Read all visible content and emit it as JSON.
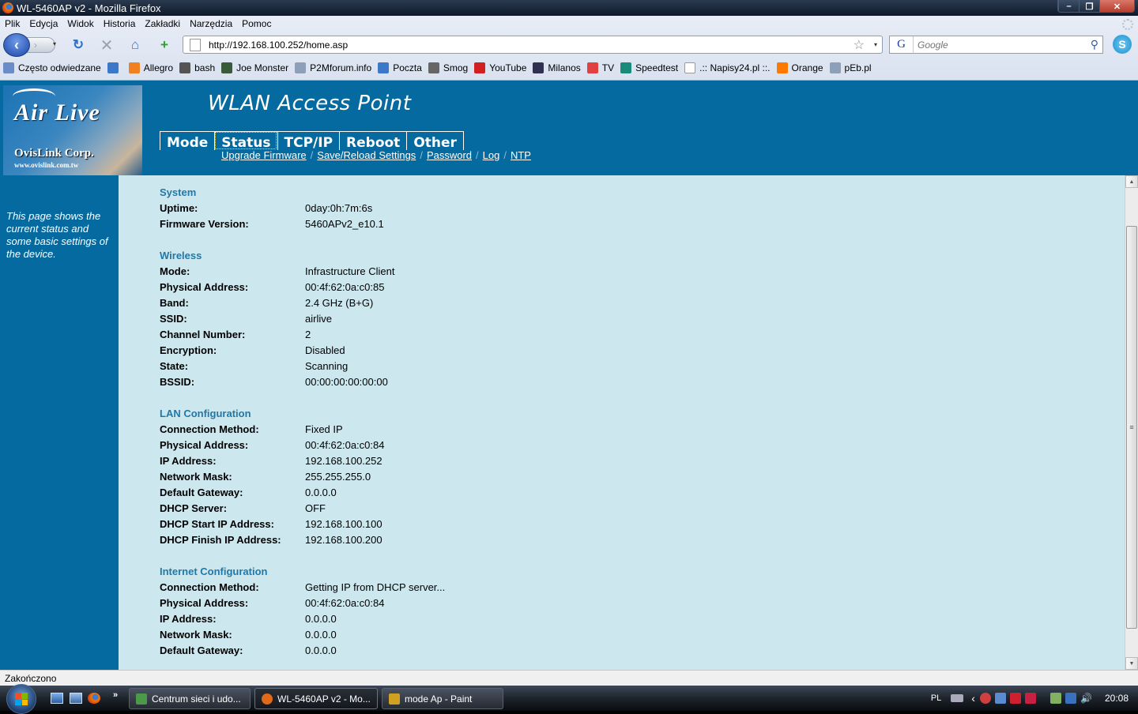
{
  "window": {
    "title": "WL-5460AP v2 - Mozilla Firefox",
    "controls": {
      "minimize": "–",
      "restore": "❐",
      "close": "✕"
    }
  },
  "menubar": [
    {
      "label": "Plik"
    },
    {
      "label": "Edycja"
    },
    {
      "label": "Widok"
    },
    {
      "label": "Historia"
    },
    {
      "label": "Zakładki"
    },
    {
      "label": "Narzędzia"
    },
    {
      "label": "Pomoc"
    }
  ],
  "toolbar": {
    "url": "http://192.168.100.252/home.asp",
    "search_placeholder": "Google",
    "icons": {
      "back": "‹",
      "forward": "›",
      "reload": "↻",
      "stop": "✕",
      "home": "⌂",
      "new_tab": "+",
      "star": "☆",
      "dropdown": "▾",
      "magnifier": "⚲",
      "search_engine": "G",
      "skype": "S"
    }
  },
  "bookmarks": [
    {
      "label": "Często odwiedzane",
      "color": "#6a8cc8"
    },
    {
      "label": "",
      "color": "#3b78c8"
    },
    {
      "label": "Allegro",
      "color": "#f08020"
    },
    {
      "label": "bash",
      "color": "#555555"
    },
    {
      "label": "Joe Monster",
      "color": "#3a5a3a"
    },
    {
      "label": "P2Mforum.info",
      "color": "#8ea0b8"
    },
    {
      "label": "Poczta",
      "color": "#3b78c8"
    },
    {
      "label": "Smog",
      "color": "#666666"
    },
    {
      "label": "YouTube",
      "color": "#d02020"
    },
    {
      "label": "Milanos",
      "color": "#303050"
    },
    {
      "label": "TV",
      "color": "#e04040"
    },
    {
      "label": "Speedtest",
      "color": "#1a8a7a"
    },
    {
      "label": ".:: Napisy24.pl ::.",
      "color": "#ffffff"
    },
    {
      "label": "Orange",
      "color": "#ff7900"
    },
    {
      "label": "pEb.pl",
      "color": "#8ea0b8"
    }
  ],
  "page": {
    "logo": {
      "brand": "Air Live",
      "company": "OvisLink Corp.",
      "website": "www.ovislink.com.tw"
    },
    "app_title": "WLAN Access Point",
    "tabs": [
      {
        "label": "Mode",
        "active": false
      },
      {
        "label": "Status",
        "active": true
      },
      {
        "label": "TCP/IP",
        "active": false
      },
      {
        "label": "Reboot",
        "active": false
      },
      {
        "label": "Other",
        "active": false
      }
    ],
    "subnav": [
      {
        "label": "Upgrade Firmware"
      },
      {
        "label": "Save/Reload Settings"
      },
      {
        "label": "Password"
      },
      {
        "label": "Log"
      },
      {
        "label": "NTP"
      }
    ],
    "subnav_separator": "/",
    "sidebar_text": "This page shows the current status and some basic settings of the device.",
    "sections": [
      {
        "title": "System",
        "rows": [
          {
            "label": "Uptime:",
            "value": "0day:0h:7m:6s"
          },
          {
            "label": "Firmware Version:",
            "value": "5460APv2_e10.1"
          }
        ]
      },
      {
        "title": "Wireless",
        "rows": [
          {
            "label": "Mode:",
            "value": "Infrastructure Client"
          },
          {
            "label": "Physical Address:",
            "value": "00:4f:62:0a:c0:85"
          },
          {
            "label": "Band:",
            "value": "2.4 GHz (B+G)"
          },
          {
            "label": "SSID:",
            "value": "airlive"
          },
          {
            "label": "Channel Number:",
            "value": "2"
          },
          {
            "label": "Encryption:",
            "value": "Disabled"
          },
          {
            "label": "State:",
            "value": "Scanning"
          },
          {
            "label": "BSSID:",
            "value": "00:00:00:00:00:00"
          }
        ]
      },
      {
        "title": "LAN Configuration",
        "rows": [
          {
            "label": "Connection Method:",
            "value": "Fixed IP"
          },
          {
            "label": "Physical Address:",
            "value": "00:4f:62:0a:c0:84"
          },
          {
            "label": "IP Address:",
            "value": "192.168.100.252"
          },
          {
            "label": "Network Mask:",
            "value": "255.255.255.0"
          },
          {
            "label": "Default Gateway:",
            "value": "0.0.0.0"
          },
          {
            "label": "DHCP Server:",
            "value": "OFF"
          },
          {
            "label": "DHCP Start IP Address:",
            "value": "192.168.100.100"
          },
          {
            "label": "DHCP Finish IP Address:",
            "value": "192.168.100.200"
          }
        ]
      },
      {
        "title": "Internet Configuration",
        "rows": [
          {
            "label": "Connection Method:",
            "value": "Getting IP from DHCP server..."
          },
          {
            "label": "Physical Address:",
            "value": "00:4f:62:0a:c0:84"
          },
          {
            "label": "IP Address:",
            "value": "0.0.0.0"
          },
          {
            "label": "Network Mask:",
            "value": "0.0.0.0"
          },
          {
            "label": "Default Gateway:",
            "value": "0.0.0.0"
          }
        ]
      }
    ],
    "scrollbar": {
      "up": "▲",
      "down": "▼",
      "grip": "≡"
    }
  },
  "statusbar": {
    "text": "Zakończono"
  },
  "taskbar": {
    "quicklaunch_more": "»",
    "tasks": [
      {
        "label": "Centrum sieci i udo...",
        "active": false,
        "color": "#4a9a4a"
      },
      {
        "label": "WL-5460AP v2 - Mo...",
        "active": true,
        "color": "#e06a1a"
      },
      {
        "label": "mode Ap - Paint",
        "active": false,
        "color": "#d0a020"
      }
    ],
    "tray": {
      "language": "PL",
      "show_hidden": "‹",
      "clock": "20:08"
    }
  },
  "colors": {
    "header_blue": "#056a9f",
    "content_bg": "#cde7ef",
    "section_title": "#1f78a8"
  }
}
